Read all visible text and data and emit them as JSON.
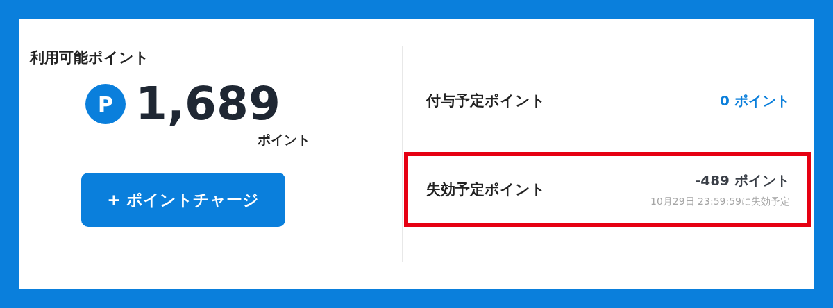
{
  "available": {
    "title": "利用可能ポイント",
    "badge": "P",
    "amount": "1,689",
    "unit": "ポイント",
    "charge_button": "+ ポイントチャージ"
  },
  "rows": [
    {
      "label": "付与予定ポイント",
      "value": "0 ポイント",
      "color": "#0b7fdb",
      "highlighted": false
    },
    {
      "label": "失効予定ポイント",
      "value": "-489 ポイント",
      "color": "#3a3f47",
      "note": "10月29日 23:59:59に失効予定",
      "highlighted": true
    }
  ]
}
